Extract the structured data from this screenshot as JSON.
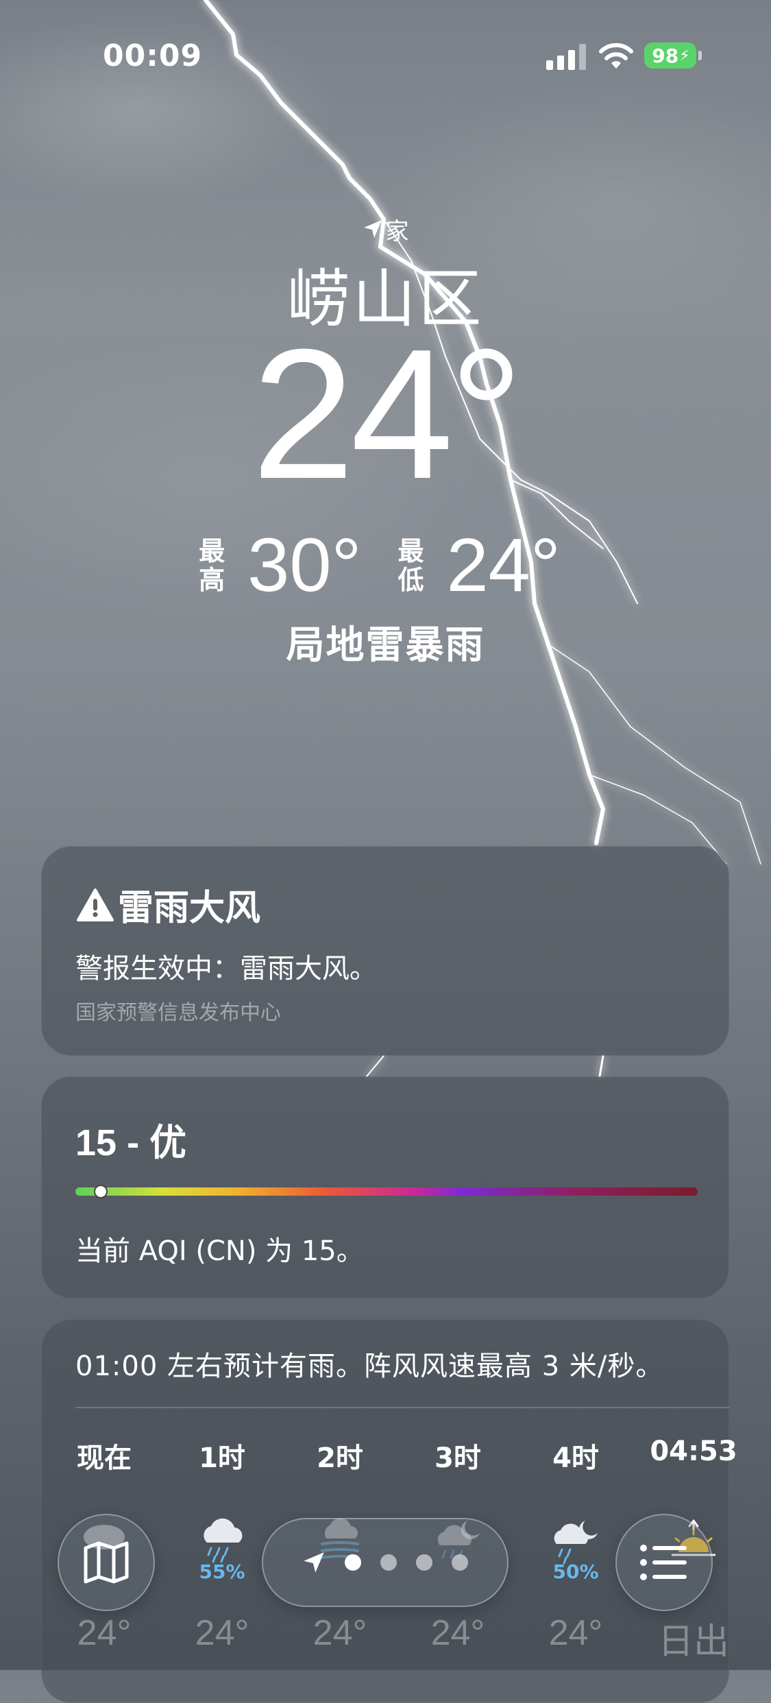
{
  "status_bar": {
    "time": "00:09",
    "battery": "98"
  },
  "location": {
    "label": "家",
    "city": "崂山区"
  },
  "current": {
    "temperature": "24°",
    "high_label": "最高",
    "high": "30°",
    "low_label": "最低",
    "low": "24°",
    "condition": "局地雷暴雨"
  },
  "alert": {
    "title": "雷雨大风",
    "body": "警报生效中：雷雨大风。",
    "source": "国家预警信息发布中心"
  },
  "aqi": {
    "title": "15 - 优",
    "level_fraction": 0.03,
    "description": "当前 AQI (CN) 为 15。"
  },
  "hourly": {
    "summary": "01:00 左右预计有雨。阵风风速最高 3 米/秒。",
    "items": [
      {
        "label": "现在",
        "icon": "cloud-rain-icon",
        "precip": "",
        "temp": "24°"
      },
      {
        "label": "1时",
        "icon": "cloud-rain-icon",
        "precip": "55%",
        "temp": "24°"
      },
      {
        "label": "2时",
        "icon": "wind-icon",
        "precip": "",
        "temp": "24°"
      },
      {
        "label": "3时",
        "icon": "cloud-moon-rain-icon",
        "precip": "",
        "temp": "24°"
      },
      {
        "label": "4时",
        "icon": "cloud-moon-rain-icon",
        "precip": "50%",
        "temp": "24°"
      },
      {
        "label": "04:53",
        "icon": "sunrise-icon",
        "precip": "",
        "temp": "日出"
      }
    ]
  },
  "toolbar": {
    "pages": 4,
    "active_page": 0
  },
  "colors": {
    "precip": "#68b8ec",
    "battery": "#5ad36a"
  }
}
